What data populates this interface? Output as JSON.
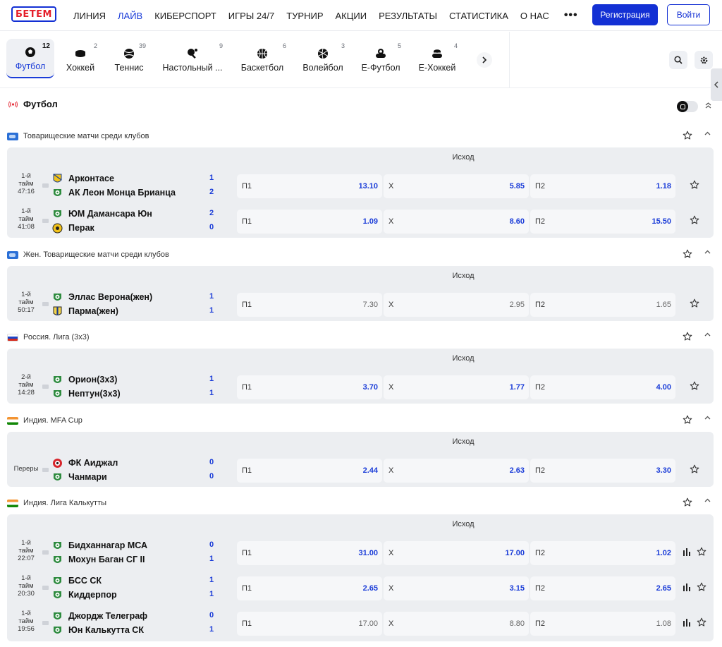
{
  "header": {
    "logo_text": "БЕТЕМ",
    "nav": [
      "ЛИНИЯ",
      "ЛАЙВ",
      "КИБЕРСПОРТ",
      "ИГРЫ 24/7",
      "ТУРНИР",
      "АКЦИИ",
      "РЕЗУЛЬТАТЫ",
      "СТАТИСТИКА",
      "О НАС"
    ],
    "active_nav": "ЛАЙВ",
    "more": "•••",
    "register_label": "Регистрация",
    "login_label": "Войти"
  },
  "sports": [
    {
      "label": "Футбол",
      "count": "12",
      "icon": "soccer-ball-icon",
      "active": true
    },
    {
      "label": "Хоккей",
      "count": "2",
      "icon": "hockey-puck-icon"
    },
    {
      "label": "Теннис",
      "count": "39",
      "icon": "tennis-ball-icon"
    },
    {
      "label": "Настольный ...",
      "count": "9",
      "icon": "table-tennis-icon"
    },
    {
      "label": "Баскетбол",
      "count": "6",
      "icon": "basketball-icon"
    },
    {
      "label": "Волейбол",
      "count": "3",
      "icon": "volleyball-icon"
    },
    {
      "label": "Е-Футбол",
      "count": "5",
      "icon": "esports-football-icon"
    },
    {
      "label": "Е-Хоккей",
      "count": "4",
      "icon": "esports-hockey-icon"
    }
  ],
  "section": {
    "title": "Футбол",
    "icon": "live-broadcast-icon"
  },
  "outcome_label": "Исход",
  "odd_labels": {
    "p1": "П1",
    "x": "Х",
    "p2": "П2"
  },
  "leagues": [
    {
      "name": "Товарищеские матчи среди клубов",
      "flag": "world",
      "matches": [
        {
          "time": [
            "1-й",
            "тайм",
            "47:16"
          ],
          "home": "Арконтасе",
          "away": "АК Леон Монца Брианца",
          "home_score": "1",
          "away_score": "2",
          "p1": "13.10",
          "x": "5.85",
          "p2": "1.18",
          "muted": false,
          "stats": false
        },
        {
          "time": [
            "1-й",
            "тайм",
            "41:08"
          ],
          "home": "ЮМ Дамансара Юн",
          "away": "Перак",
          "home_score": "2",
          "away_score": "0",
          "p1": "1.09",
          "x": "8.60",
          "p2": "15.50",
          "muted": false,
          "stats": false
        }
      ]
    },
    {
      "name": "Жен. Товарищеские матчи среди клубов",
      "flag": "world",
      "matches": [
        {
          "time": [
            "1-й",
            "тайм",
            "50:17"
          ],
          "home": "Эллас Верона(жен)",
          "away": "Парма(жен)",
          "home_score": "1",
          "away_score": "1",
          "p1": "7.30",
          "x": "2.95",
          "p2": "1.65",
          "muted": true,
          "stats": false
        }
      ]
    },
    {
      "name": "Россия. Лига (3x3)",
      "flag": "ru",
      "matches": [
        {
          "time": [
            "2-й",
            "тайм",
            "14:28"
          ],
          "home": "Орион(3x3)",
          "away": "Нептун(3x3)",
          "home_score": "1",
          "away_score": "1",
          "p1": "3.70",
          "x": "1.77",
          "p2": "4.00",
          "muted": false,
          "stats": false
        }
      ]
    },
    {
      "name": "Индия. MFA Cup",
      "flag": "in",
      "matches": [
        {
          "time": [
            "Переры"
          ],
          "home": "ФК Аиджал",
          "away": "Чанмари",
          "home_score": "0",
          "away_score": "0",
          "p1": "2.44",
          "x": "2.63",
          "p2": "3.30",
          "muted": false,
          "stats": false
        }
      ]
    },
    {
      "name": "Индия. Лига Калькутты",
      "flag": "in",
      "matches": [
        {
          "time": [
            "1-й",
            "тайм",
            "22:07"
          ],
          "home": "Бидханнагар МСА",
          "away": "Мохун Баган СГ II",
          "home_score": "0",
          "away_score": "1",
          "p1": "31.00",
          "x": "17.00",
          "p2": "1.02",
          "muted": false,
          "stats": true
        },
        {
          "time": [
            "1-й",
            "тайм",
            "20:30"
          ],
          "home": "БСС СК",
          "away": "Киддерпор",
          "home_score": "1",
          "away_score": "1",
          "p1": "2.65",
          "x": "3.15",
          "p2": "2.65",
          "muted": false,
          "stats": true
        },
        {
          "time": [
            "1-й",
            "тайм",
            "19:56"
          ],
          "home": "Джордж Телеграф",
          "away": "Юн Калькутта СК",
          "home_score": "0",
          "away_score": "1",
          "p1": "17.00",
          "x": "8.80",
          "p2": "1.08",
          "muted": true,
          "stats": true
        }
      ]
    }
  ]
}
